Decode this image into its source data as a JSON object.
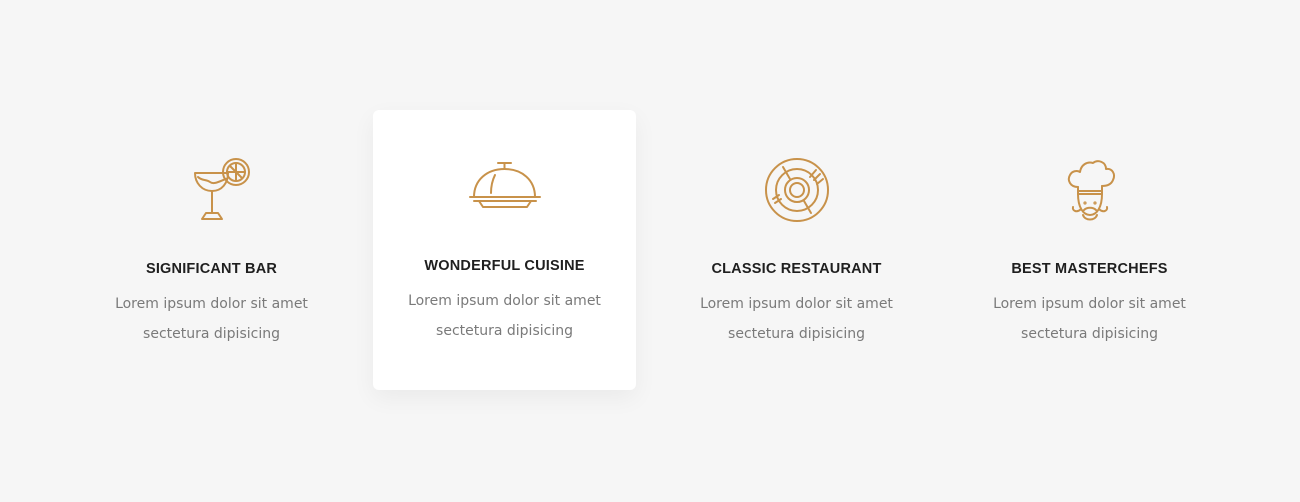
{
  "accent_color": "#c8924a",
  "features": [
    {
      "icon": "cocktail-glass-icon",
      "title": "SIGNIFICANT BAR",
      "desc_line1": "Lorem ipsum dolor sit amet",
      "desc_line2": "sectetura dipisicing"
    },
    {
      "icon": "food-cloche-icon",
      "title": "WONDERFUL CUISINE",
      "desc_line1": "Lorem ipsum dolor sit amet",
      "desc_line2": "sectetura dipisicing"
    },
    {
      "icon": "plate-icon",
      "title": "CLASSIC RESTAURANT",
      "desc_line1": "Lorem ipsum dolor sit amet",
      "desc_line2": "sectetura dipisicing"
    },
    {
      "icon": "chef-icon",
      "title": "BEST MASTERCHEFS",
      "desc_line1": "Lorem ipsum dolor sit amet",
      "desc_line2": "sectetura dipisicing"
    }
  ]
}
